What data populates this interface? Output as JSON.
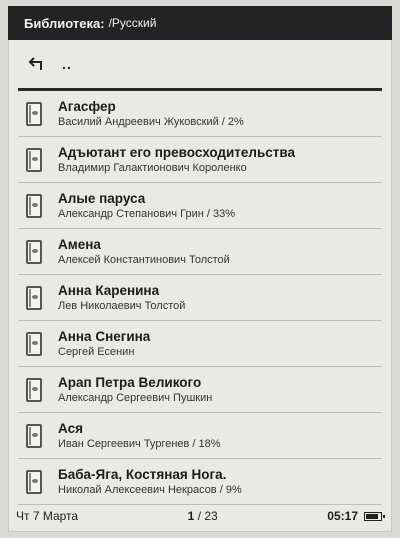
{
  "header": {
    "library_label": "Библиотека:",
    "path": "/Русский"
  },
  "nav": {
    "up_label": ".."
  },
  "books": [
    {
      "title": "Агасфер",
      "subtitle": "Василий Андреевич Жуковский / 2%"
    },
    {
      "title": "Адъютант его превосходительства",
      "subtitle": "Владимир Галактионович Короленко"
    },
    {
      "title": "Алые паруса",
      "subtitle": "Александр Степанович Грин / 33%"
    },
    {
      "title": "Амена",
      "subtitle": "Алексей Константинович Толстой"
    },
    {
      "title": "Анна Каренина",
      "subtitle": "Лев Николаевич Толстой"
    },
    {
      "title": "Анна Снегина",
      "subtitle": "Сергей Есенин"
    },
    {
      "title": "Арап Петра Великого",
      "subtitle": "Александр Сергеевич Пушкин"
    },
    {
      "title": "Ася",
      "subtitle": "Иван Сергеевич Тургенев / 18%"
    },
    {
      "title": "Баба-Яга, Костяная Нога.",
      "subtitle": "Николай Алексеевич Некрасов / 9%"
    }
  ],
  "status": {
    "date": "Чт 7 Марта",
    "page_current": "1",
    "page_total": "/ 23",
    "time": "05:17",
    "battery_level": 0.85
  },
  "icons": {
    "back": "back-arrow-icon",
    "book": "book-icon",
    "battery": "battery-icon"
  }
}
